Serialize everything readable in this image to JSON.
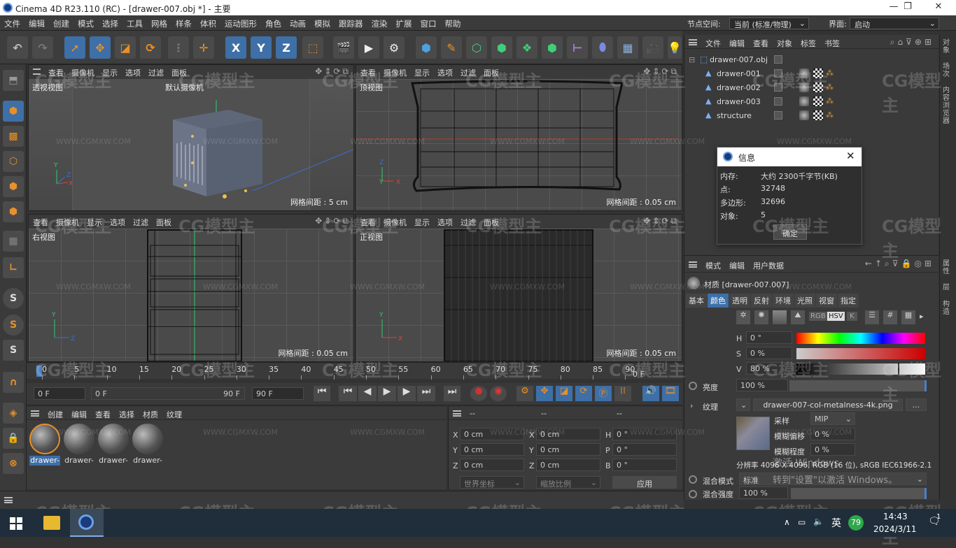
{
  "titlebar": {
    "title": "Cinema 4D R23.110 (RC) - [drawer-007.obj *] - 主要"
  },
  "menubar": {
    "items": [
      "文件",
      "编辑",
      "创建",
      "模式",
      "选择",
      "工具",
      "网格",
      "样条",
      "体积",
      "运动图形",
      "角色",
      "动画",
      "模拟",
      "跟踪器",
      "渲染",
      "扩展",
      "窗口",
      "帮助"
    ],
    "node_space_label": "节点空间:",
    "node_space_value": "当前 (标准/物理)",
    "layout_label": "界面:",
    "layout_value": "启动"
  },
  "toolbar": {
    "xyz": [
      "X",
      "Y",
      "Z"
    ]
  },
  "viewports": {
    "menu": [
      "查看",
      "摄像机",
      "显示",
      "选项",
      "过滤",
      "面板"
    ],
    "perspective": {
      "label": "透视视图",
      "camera": "默认摄像机",
      "grid": "网格间距 : 5 cm"
    },
    "top": {
      "label": "顶视图",
      "grid": "网格间距 : 0.05 cm"
    },
    "right": {
      "label": "右视图",
      "grid": "网格间距 : 0.05 cm"
    },
    "front": {
      "label": "正视图",
      "grid": "网格间距 : 0.05 cm"
    }
  },
  "timeline": {
    "ticks": [
      "0",
      "5",
      "10",
      "15",
      "20",
      "25",
      "30",
      "35",
      "40",
      "45",
      "50",
      "55",
      "60",
      "65",
      "70",
      "75",
      "80",
      "85",
      "90"
    ],
    "end_label": "0 F",
    "start_field": "0 F",
    "range_start": "0 F",
    "range_end": "90 F",
    "end_field": "90 F"
  },
  "material_manager": {
    "menu": [
      "创建",
      "编辑",
      "查看",
      "选择",
      "材质",
      "纹理"
    ],
    "materials": [
      "drawer-",
      "drawer-",
      "drawer-",
      "drawer-"
    ]
  },
  "coordinates": {
    "headers": [
      "--",
      "--",
      "--"
    ],
    "rows": [
      {
        "a": "X",
        "av": "0 cm",
        "b": "X",
        "bv": "0 cm",
        "c": "H",
        "cv": "0 °"
      },
      {
        "a": "Y",
        "av": "0 cm",
        "b": "Y",
        "bv": "0 cm",
        "c": "P",
        "cv": "0 °"
      },
      {
        "a": "Z",
        "av": "0 cm",
        "b": "Z",
        "bv": "0 cm",
        "c": "B",
        "cv": "0 °"
      }
    ],
    "world": "世界坐标",
    "scale": "缩放比例",
    "apply": "应用"
  },
  "object_manager": {
    "menu": [
      "文件",
      "编辑",
      "查看",
      "对象",
      "标签",
      "书签"
    ],
    "root": "drawer-007.obj",
    "children": [
      "drawer-001",
      "drawer-002",
      "drawer-003",
      "structure"
    ]
  },
  "info_dialog": {
    "title": "信息",
    "rows": [
      {
        "k": "内存:",
        "v": "大约 2300千字节(KB)"
      },
      {
        "k": "点:",
        "v": "32748"
      },
      {
        "k": "多边形:",
        "v": "32696"
      },
      {
        "k": "对象:",
        "v": "5"
      }
    ],
    "ok": "确定"
  },
  "attribute_manager": {
    "menu": [
      "模式",
      "编辑",
      "用户数据"
    ],
    "material": "材质 [drawer-007.007]",
    "tabs": [
      "基本",
      "颜色",
      "透明",
      "反射",
      "环境",
      "光照",
      "视窗",
      "指定"
    ],
    "active_tab": "颜色",
    "color_modes": [
      "RGB",
      "HSV",
      "K"
    ],
    "h": "0 °",
    "s": "0 %",
    "v": "80 %",
    "brightness_label": "亮度",
    "brightness": "100 %",
    "texture_label": "纹理",
    "texture_file": "drawer-007-col-metalness-4k.png",
    "sampling_label": "采样",
    "sampling": "MIP",
    "blur_offset_label": "模糊偏移",
    "blur_offset": "0 %",
    "blur_scale_label": "模糊程度",
    "blur_scale": "0 %",
    "resolution": "分辨率 4096 X 4096, RGB (16 位), sRGB IEC61966-2.1",
    "blend_mode_label": "混合模式",
    "blend_mode": "标准",
    "blend_strength_label": "混合强度",
    "blend_strength": "100 %",
    "activate1": "激活 Windows",
    "activate2": "转到\"设置\"以激活 Windows。"
  },
  "right_strip": [
    "对象",
    "场次",
    "内容浏览器",
    "属性",
    "层",
    "构造"
  ],
  "taskbar": {
    "lang": "英",
    "badge": "79",
    "time": "14:43",
    "date": "2024/3/11",
    "notif": "1"
  },
  "watermark": {
    "brand": "CG模型主",
    "url": "WWW.CGMXW.COM"
  },
  "colors": {
    "accent": "#3e6fa7",
    "orange": "#e8902a"
  }
}
